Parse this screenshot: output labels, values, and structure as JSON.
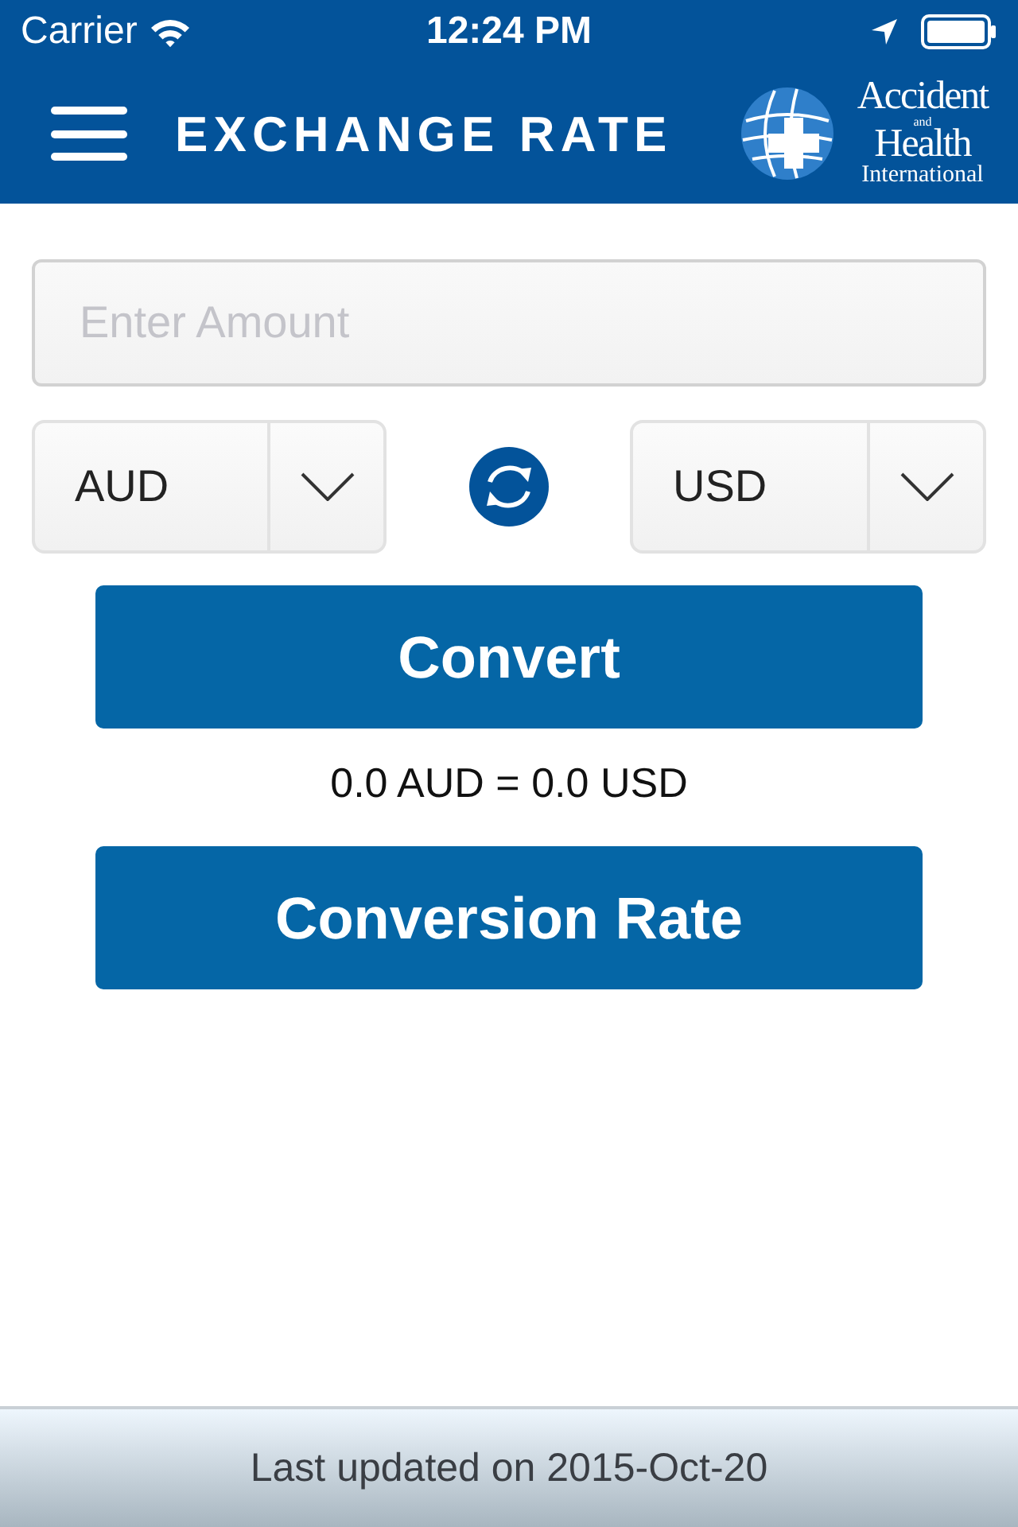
{
  "status_bar": {
    "carrier": "Carrier",
    "time": "12:24 PM"
  },
  "nav_bar": {
    "title": "EXCHANGE RATE",
    "logo": {
      "line_1": "Accident",
      "line_2": "and",
      "line_3": "Health",
      "line_4": "International"
    }
  },
  "amount_field": {
    "placeholder": "Enter Amount"
  },
  "from_currency": {
    "value": "AUD"
  },
  "to_currency": {
    "value": "USD"
  },
  "convert_button": {
    "label": "Convert"
  },
  "result": "0.0 AUD = 0.0 USD",
  "rate_button": {
    "label": "Conversion Rate"
  },
  "footer": {
    "text": "Last updated on 2015-Oct-20"
  }
}
